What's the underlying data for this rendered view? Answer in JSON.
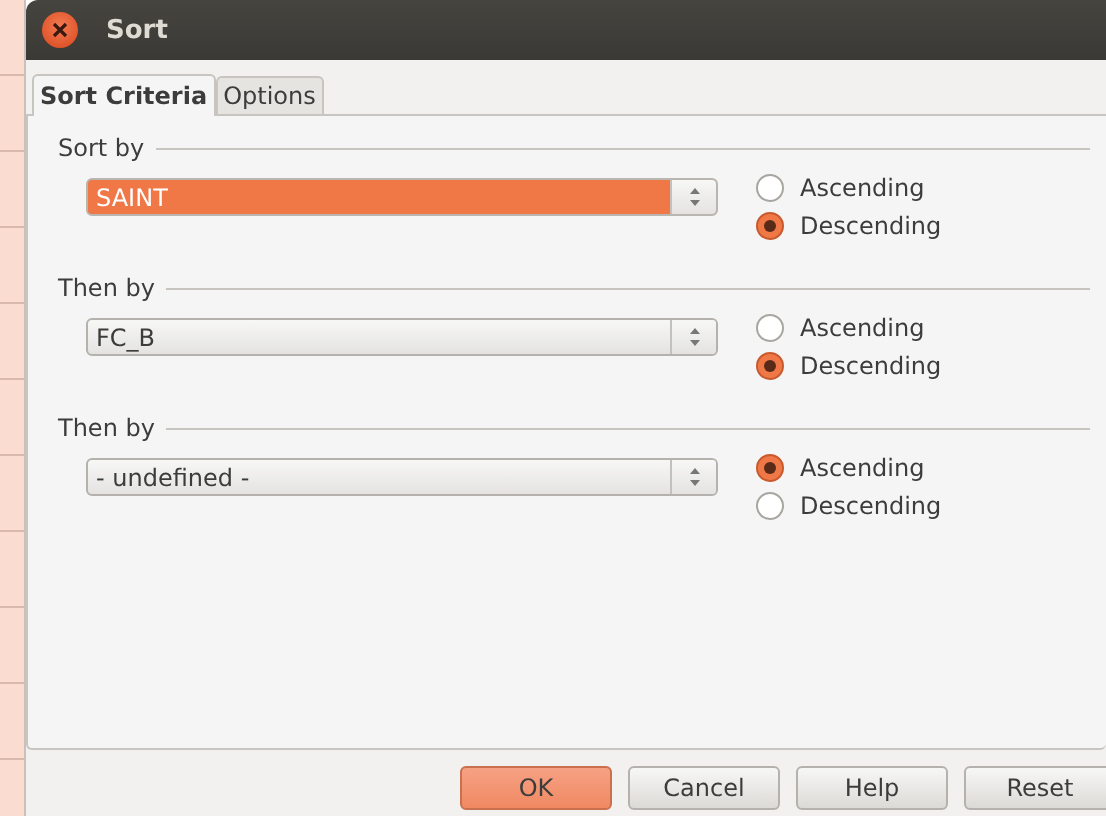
{
  "window": {
    "title": "Sort"
  },
  "tabs": [
    {
      "label": "Sort Criteria",
      "selected": true
    },
    {
      "label": "Options",
      "selected": false
    }
  ],
  "criteria": [
    {
      "label": "Sort by",
      "value": "SAINT",
      "focused": true,
      "orders": [
        {
          "label": "Ascending",
          "selected": false
        },
        {
          "label": "Descending",
          "selected": true
        }
      ]
    },
    {
      "label": "Then by",
      "value": "FC_B",
      "focused": false,
      "orders": [
        {
          "label": "Ascending",
          "selected": false
        },
        {
          "label": "Descending",
          "selected": true
        }
      ]
    },
    {
      "label": "Then by",
      "value": "- undefined -",
      "focused": false,
      "orders": [
        {
          "label": "Ascending",
          "selected": true
        },
        {
          "label": "Descending",
          "selected": false
        }
      ]
    }
  ],
  "buttons": [
    {
      "label": "OK",
      "default": true
    },
    {
      "label": "Cancel",
      "default": false
    },
    {
      "label": "Help",
      "default": false
    },
    {
      "label": "Reset",
      "default": false
    }
  ]
}
